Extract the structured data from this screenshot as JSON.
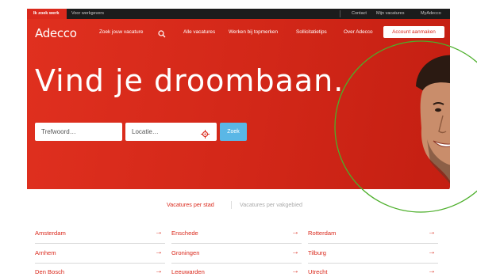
{
  "topbar": {
    "tabs": [
      "Ik zoek werk",
      "Voor werkgevers"
    ],
    "links": [
      "Contact",
      "Mijn vacatures",
      "MyAdecco"
    ]
  },
  "nav": {
    "logo": "Adecco",
    "search_label": "Zoek jouw vacature",
    "items": [
      "Alle vacatures",
      "Werken bij topmerken",
      "Sollicitatietips",
      "Over Adecco"
    ],
    "cta": "Account aanmaken"
  },
  "hero": {
    "headline": "Vind je droombaan.",
    "keyword_placeholder": "Trefwoord…",
    "location_placeholder": "Locatie…",
    "search_button": "Zoek"
  },
  "section_tabs": [
    "Vacatures per stad",
    "Vacatures per vakgebied"
  ],
  "cities": {
    "col1": [
      "Amsterdam",
      "Arnhem",
      "Den Bosch"
    ],
    "col2": [
      "Enschede",
      "Groningen",
      "Leeuwarden"
    ],
    "col3": [
      "Rotterdam",
      "Tilburg",
      "Utrecht"
    ]
  },
  "colors": {
    "brand_red": "#da291c",
    "search_blue": "#5ab7e6",
    "topbar_dark": "#1c1c1c",
    "circle_green": "#4caf2a"
  },
  "icons": {
    "arrow": "→"
  }
}
